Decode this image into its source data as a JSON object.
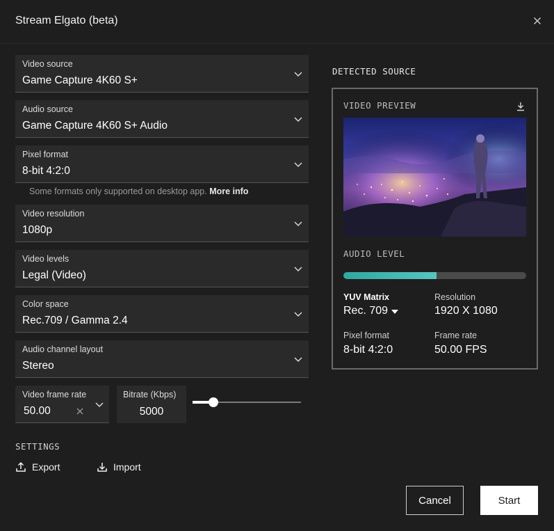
{
  "window": {
    "title": "Stream Elgato (beta)"
  },
  "fields": {
    "video_source": {
      "label": "Video source",
      "value": "Game Capture 4K60 S+"
    },
    "audio_source": {
      "label": "Audio source",
      "value": "Game Capture 4K60 S+ Audio"
    },
    "pixel_format": {
      "label": "Pixel format",
      "value": "8-bit 4:2:0"
    },
    "video_resolution": {
      "label": "Video resolution",
      "value": "1080p"
    },
    "video_levels": {
      "label": "Video levels",
      "value": "Legal (Video)"
    },
    "color_space": {
      "label": "Color space",
      "value": "Rec.709 / Gamma 2.4"
    },
    "audio_channel_layout": {
      "label": "Audio channel layout",
      "value": "Stereo"
    }
  },
  "pixel_format_hint": {
    "text": "Some formats only supported on desktop app.",
    "link": "More info"
  },
  "frame_rate": {
    "label": "Video frame rate",
    "value": "50.00"
  },
  "bitrate": {
    "label": "Bitrate (Kbps)",
    "value": "5000",
    "slider_fraction": 0.16
  },
  "settings": {
    "label": "SETTINGS",
    "export_label": "Export",
    "import_label": "Import"
  },
  "detected": {
    "section_label": "DETECTED SOURCE",
    "preview_label": "VIDEO PREVIEW",
    "audio_level_label": "AUDIO LEVEL",
    "audio_level_fraction": 0.51,
    "yuv_matrix": {
      "label": "YUV Matrix",
      "value": "Rec. 709"
    },
    "resolution": {
      "label": "Resolution",
      "value": "1920 X 1080"
    },
    "pixel_format": {
      "label": "Pixel format",
      "value": "8-bit 4:2:0"
    },
    "frame_rate": {
      "label": "Frame rate",
      "value": "50.00 FPS"
    }
  },
  "buttons": {
    "cancel": "Cancel",
    "start": "Start"
  },
  "colors": {
    "background": "#1e1e1e",
    "field": "#2a2a2a",
    "accent_teal": "#3bb3ad",
    "primary_button": "#ffffff"
  }
}
